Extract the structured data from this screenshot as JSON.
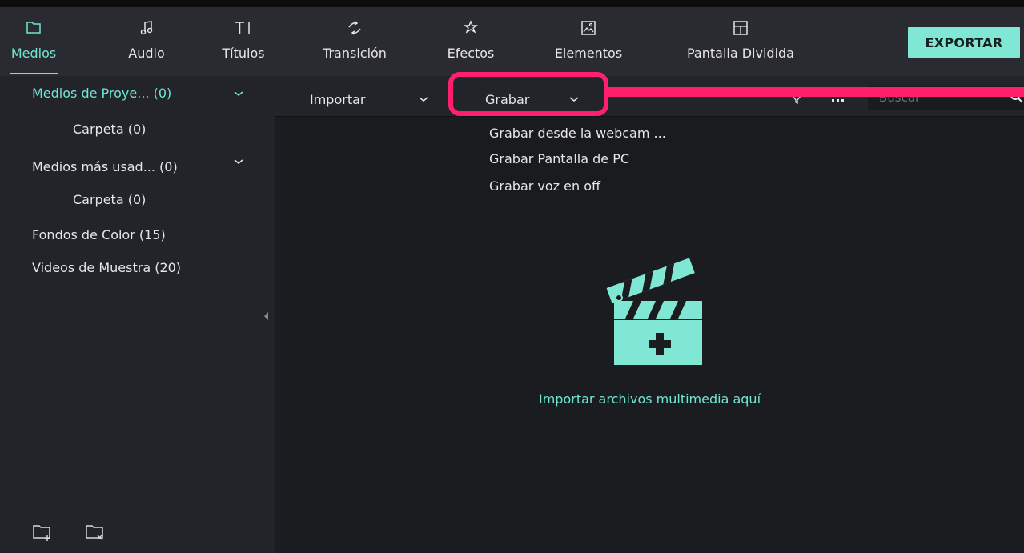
{
  "toolbar": {
    "tabs": [
      {
        "label": "Medios",
        "icon": "folder-icon"
      },
      {
        "label": "Audio",
        "icon": "music-note-icon"
      },
      {
        "label": "Títulos",
        "icon": "text-title-icon"
      },
      {
        "label": "Transición",
        "icon": "transition-icon"
      },
      {
        "label": "Efectos",
        "icon": "effects-icon"
      },
      {
        "label": "Elementos",
        "icon": "image-element-icon"
      },
      {
        "label": "Pantalla Dividida",
        "icon": "split-screen-icon"
      }
    ],
    "active_tab": "Medios",
    "export_label": "EXPORTAR"
  },
  "sidebar": {
    "items": [
      {
        "label": "Medios de Proye... (0)",
        "active": true,
        "expandable": true
      },
      {
        "label": "Carpeta (0)",
        "indent": true
      },
      {
        "label": "Medios más usad... (0)",
        "expandable": true
      },
      {
        "label": "Carpeta (0)",
        "indent": true
      },
      {
        "label": "Fondos de Color (15)"
      },
      {
        "label": "Videos de Muestra (20)"
      }
    ],
    "bottom_icons": [
      "new-folder-icon",
      "delete-folder-icon"
    ]
  },
  "subbar": {
    "import_label": "Importar",
    "record_label": "Grabar",
    "search_placeholder": "Buscar"
  },
  "record_menu": {
    "options": [
      "Grabar desde la webcam ...",
      "Grabar Pantalla de PC",
      "Grabar voz en off"
    ]
  },
  "main": {
    "empty_text": "Importar archivos multimedia aquí"
  },
  "colors": {
    "accent": "#6ee6d2",
    "export_button": "#7fe7d4",
    "annotation": "#ff1f6d"
  }
}
